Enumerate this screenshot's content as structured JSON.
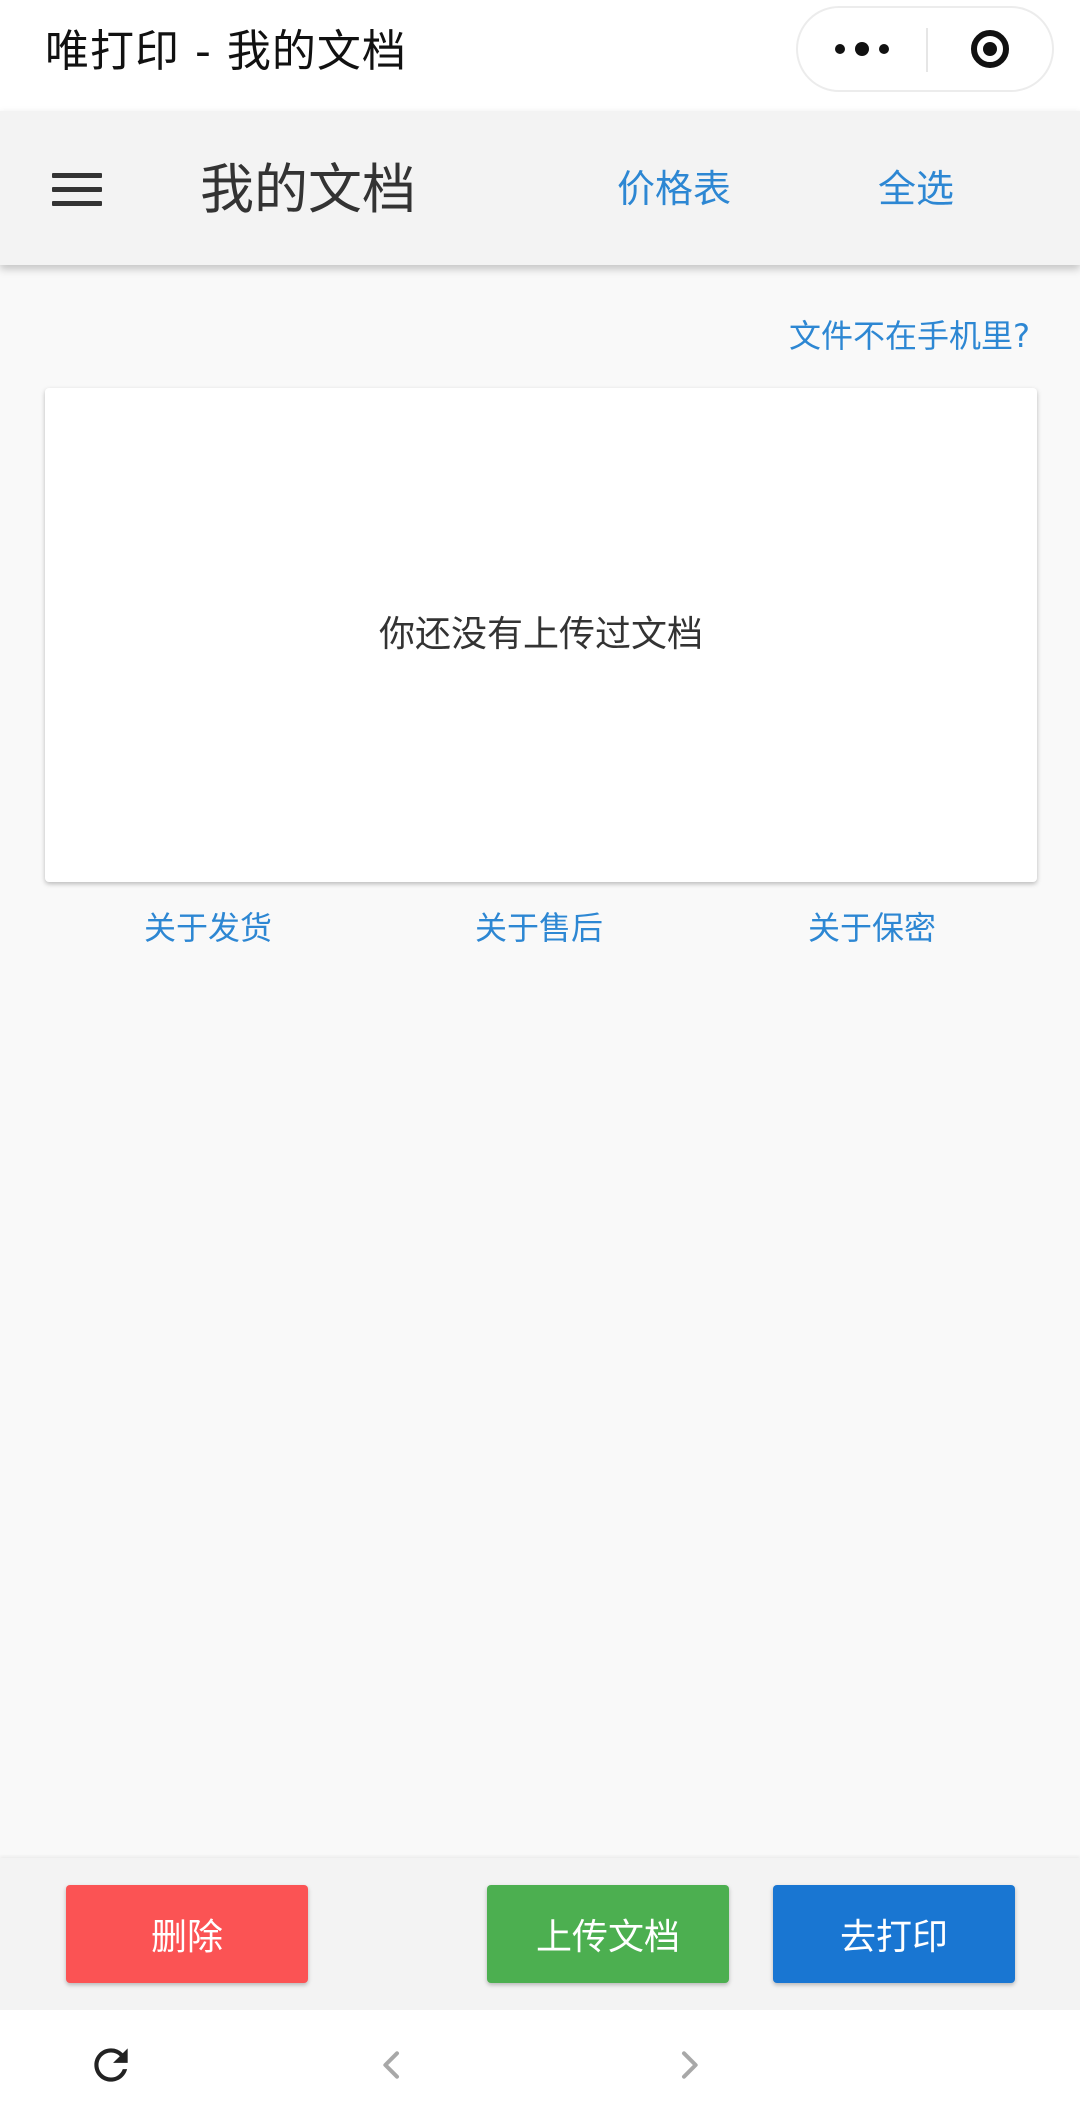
{
  "miniapp": {
    "title": "唯打印 - 我的文档"
  },
  "header": {
    "title": "我的文档",
    "price_link": "价格表",
    "select_all": "全选"
  },
  "content": {
    "help_link": "文件不在手机里?",
    "empty_message": "你还没有上传过文档"
  },
  "info_links": {
    "shipping": "关于发货",
    "after_sales": "关于售后",
    "privacy": "关于保密"
  },
  "actions": {
    "delete": "删除",
    "upload": "上传文档",
    "print": "去打印"
  },
  "colors": {
    "delete": "#fb5354",
    "upload": "#4caf50",
    "print": "#1976d2",
    "link": "#2d87d3"
  },
  "icons": {
    "menu": "hamburger-menu-icon",
    "more": "more-dots-icon",
    "close": "target-close-icon",
    "refresh": "refresh-icon",
    "back": "chevron-left-icon",
    "forward": "chevron-right-icon"
  }
}
